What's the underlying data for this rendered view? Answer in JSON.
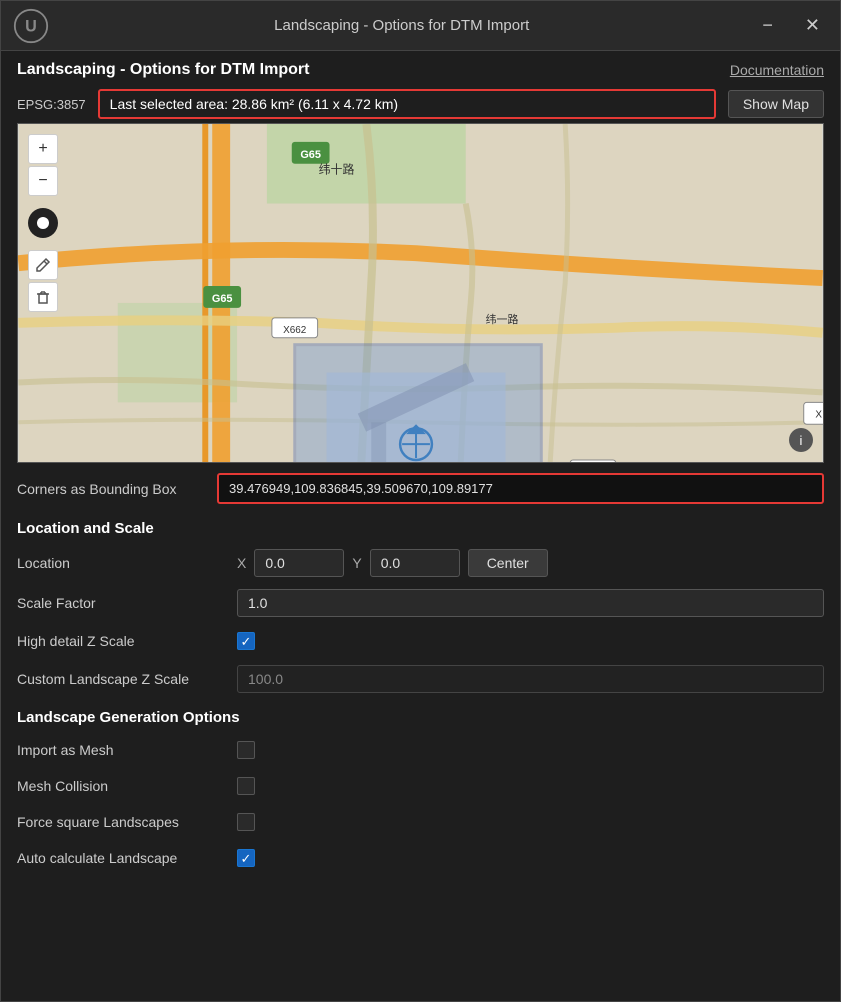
{
  "titlebar": {
    "title": "Landscaping - Options for DTM Import",
    "minimize_label": "−",
    "close_label": "✕"
  },
  "header": {
    "title": "Landscaping - Options for DTM Import",
    "documentation_label": "Documentation"
  },
  "map_toolbar": {
    "epsg": "EPSG:3857",
    "selected_area": "Last selected area: 28.86 km² (6.11 x 4.72 km)",
    "show_map_label": "Show Map"
  },
  "map_controls": {
    "zoom_in": "+",
    "zoom_out": "−",
    "info": "ⓘ"
  },
  "corners": {
    "label": "Corners as Bounding Box",
    "value": "39.476949,109.836845,39.509670,109.89177"
  },
  "location_scale_section": {
    "title": "Location and Scale"
  },
  "location": {
    "label": "Location",
    "x_label": "X",
    "x_value": "0.0",
    "y_label": "Y",
    "y_value": "0.0",
    "center_label": "Center"
  },
  "scale_factor": {
    "label": "Scale Factor",
    "value": "1.0"
  },
  "high_detail_z_scale": {
    "label": "High detail Z Scale",
    "checked": true
  },
  "custom_landscape_z_scale": {
    "label": "Custom Landscape Z Scale",
    "value": "100.0",
    "disabled": true
  },
  "landscape_gen_section": {
    "title": "Landscape Generation Options"
  },
  "import_as_mesh": {
    "label": "Import as Mesh",
    "checked": false
  },
  "mesh_collision": {
    "label": "Mesh Collision",
    "checked": false
  },
  "force_square": {
    "label": "Force square Landscapes",
    "checked": false
  },
  "auto_calculate": {
    "label": "Auto calculate Landscape",
    "checked": true
  }
}
